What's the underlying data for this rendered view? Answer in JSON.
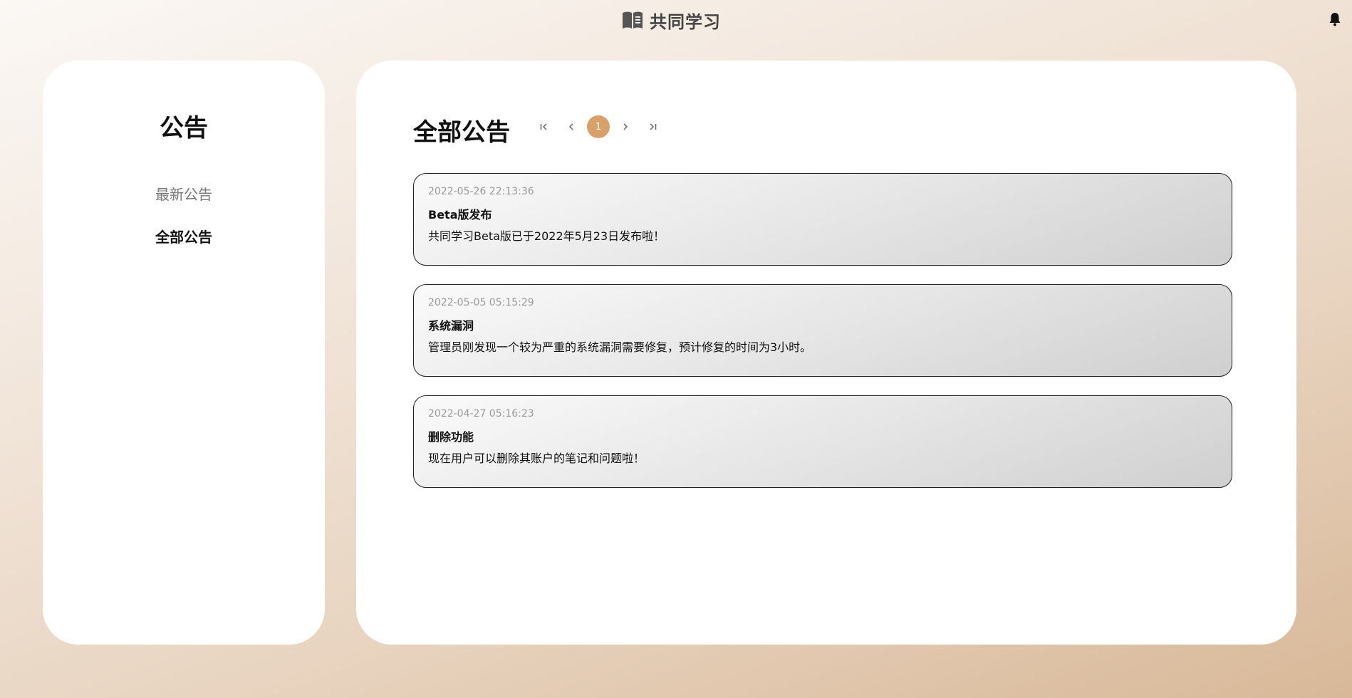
{
  "header": {
    "brand_icon": "book-icon",
    "brand_title": "共同学习",
    "notification_icon": "bell-icon"
  },
  "sidebar": {
    "title": "公告",
    "items": [
      {
        "label": "最新公告",
        "active": false
      },
      {
        "label": "全部公告",
        "active": true
      }
    ]
  },
  "main": {
    "title": "全部公告",
    "pagination": {
      "current_page": "1",
      "accent_color": "#d9a06a",
      "icons": [
        "first-page-icon",
        "prev-page-icon",
        "next-page-icon",
        "last-page-icon"
      ]
    },
    "announcements": [
      {
        "date": "2022-05-26 22:13:36",
        "title": "Beta版发布",
        "body": "共同学习Beta版已于2022年5月23日发布啦！"
      },
      {
        "date": "2022-05-05 05:15:29",
        "title": "系统漏洞",
        "body": "管理员刚发现一个较为严重的系统漏洞需要修复，预计修复的时间为3小时。"
      },
      {
        "date": "2022-04-27 05:16:23",
        "title": "删除功能",
        "body": "现在用户可以删除其账户的笔记和问题啦！"
      }
    ]
  }
}
